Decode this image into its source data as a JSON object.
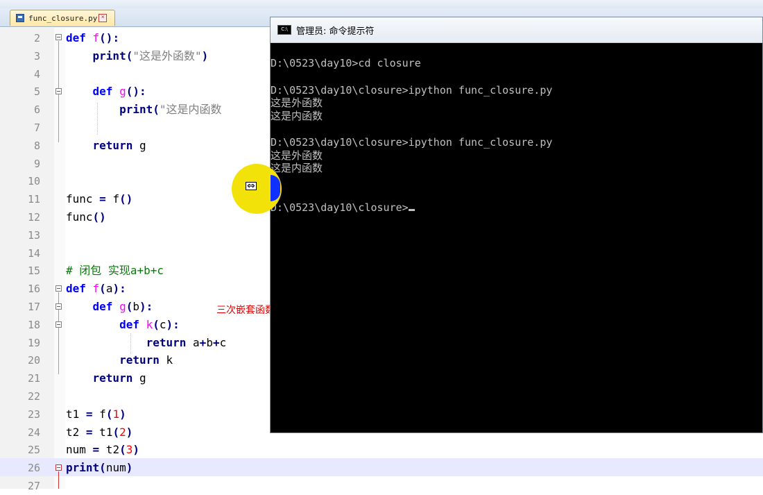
{
  "tab": {
    "filename": "func_closure.py",
    "close_glyph": "×"
  },
  "editor": {
    "lines": [
      {
        "n": "2",
        "parts": [
          [
            "kw",
            "def "
          ],
          [
            "fn",
            "f"
          ],
          [
            "op",
            "():"
          ]
        ]
      },
      {
        "n": "3",
        "parts": [
          [
            "",
            "    "
          ],
          [
            "kwb",
            "print"
          ],
          [
            "op",
            "("
          ],
          [
            "str",
            "\"这是外函数\""
          ],
          [
            "op",
            ")"
          ]
        ]
      },
      {
        "n": "4",
        "parts": []
      },
      {
        "n": "5",
        "parts": [
          [
            "",
            "    "
          ],
          [
            "kw",
            "def "
          ],
          [
            "fn",
            "g"
          ],
          [
            "op",
            "():"
          ]
        ]
      },
      {
        "n": "6",
        "parts": [
          [
            "",
            "        "
          ],
          [
            "kwb",
            "print"
          ],
          [
            "op",
            "("
          ],
          [
            "str",
            "\"这是内函数"
          ]
        ]
      },
      {
        "n": "7",
        "parts": []
      },
      {
        "n": "8",
        "parts": [
          [
            "",
            "    "
          ],
          [
            "kwb",
            "return "
          ],
          [
            "",
            "g"
          ]
        ]
      },
      {
        "n": "9",
        "parts": []
      },
      {
        "n": "10",
        "parts": []
      },
      {
        "n": "11",
        "parts": [
          [
            "",
            "func "
          ],
          [
            "op",
            "="
          ],
          [
            "",
            " f"
          ],
          [
            "op",
            "()"
          ]
        ]
      },
      {
        "n": "12",
        "parts": [
          [
            "",
            "func"
          ],
          [
            "op",
            "()"
          ]
        ]
      },
      {
        "n": "13",
        "parts": []
      },
      {
        "n": "14",
        "parts": []
      },
      {
        "n": "15",
        "parts": [
          [
            "cm",
            "# 闭包 实现a+b+c"
          ]
        ]
      },
      {
        "n": "16",
        "parts": [
          [
            "kw",
            "def "
          ],
          [
            "fn",
            "f"
          ],
          [
            "op",
            "("
          ],
          [
            "",
            "a"
          ],
          [
            "op",
            "):"
          ]
        ]
      },
      {
        "n": "17",
        "parts": [
          [
            "",
            "    "
          ],
          [
            "kw",
            "def "
          ],
          [
            "fn",
            "g"
          ],
          [
            "op",
            "("
          ],
          [
            "",
            "b"
          ],
          [
            "op",
            "):"
          ]
        ]
      },
      {
        "n": "18",
        "parts": [
          [
            "",
            "        "
          ],
          [
            "kw",
            "def "
          ],
          [
            "fn",
            "k"
          ],
          [
            "op",
            "("
          ],
          [
            "",
            "c"
          ],
          [
            "op",
            "):"
          ]
        ]
      },
      {
        "n": "19",
        "parts": [
          [
            "",
            "            "
          ],
          [
            "kwb",
            "return "
          ],
          [
            "",
            "a"
          ],
          [
            "op",
            "+"
          ],
          [
            "",
            "b"
          ],
          [
            "op",
            "+"
          ],
          [
            "",
            "c"
          ]
        ]
      },
      {
        "n": "20",
        "parts": [
          [
            "",
            "        "
          ],
          [
            "kwb",
            "return "
          ],
          [
            "",
            "k"
          ]
        ]
      },
      {
        "n": "21",
        "parts": [
          [
            "",
            "    "
          ],
          [
            "kwb",
            "return "
          ],
          [
            "",
            "g"
          ]
        ]
      },
      {
        "n": "22",
        "parts": []
      },
      {
        "n": "23",
        "parts": [
          [
            "",
            "t1 "
          ],
          [
            "op",
            "="
          ],
          [
            "",
            " f"
          ],
          [
            "op",
            "("
          ],
          [
            "num",
            "1"
          ],
          [
            "op",
            ")"
          ]
        ]
      },
      {
        "n": "24",
        "parts": [
          [
            "",
            "t2 "
          ],
          [
            "op",
            "="
          ],
          [
            "",
            " t1"
          ],
          [
            "op",
            "("
          ],
          [
            "num",
            "2"
          ],
          [
            "op",
            ")"
          ]
        ]
      },
      {
        "n": "25",
        "parts": [
          [
            "",
            "num "
          ],
          [
            "op",
            "="
          ],
          [
            "",
            " t2"
          ],
          [
            "op",
            "("
          ],
          [
            "num",
            "3"
          ],
          [
            "op",
            ")"
          ]
        ]
      },
      {
        "n": "26",
        "parts": [
          [
            "kwb",
            "print"
          ],
          [
            "op",
            "("
          ],
          [
            "",
            "num"
          ],
          [
            "op",
            ")"
          ]
        ]
      },
      {
        "n": "27",
        "parts": []
      }
    ],
    "annotation": "三次嵌套函数形成的闭包"
  },
  "cmd": {
    "title": "管理员: 命令提示符",
    "icon_text": "C:\\",
    "output": [
      {
        "row": 1,
        "text": "D:\\0523\\day10>cd closure"
      },
      {
        "row": 3,
        "text": "D:\\0523\\day10\\closure>ipython func_closure.py"
      },
      {
        "row": 4,
        "text": "这是外函数"
      },
      {
        "row": 5,
        "text": "这是内函数"
      },
      {
        "row": 7,
        "text": "D:\\0523\\day10\\closure>ipython func_closure.py"
      },
      {
        "row": 8,
        "text": "这是外函数"
      },
      {
        "row": 9,
        "text": "这是内函数"
      },
      {
        "row": 10,
        "text": "6"
      },
      {
        "row": 12,
        "text": "D:\\0523\\day10\\closure>",
        "cursor": true
      }
    ]
  },
  "mouse": {
    "glyph": "⇔"
  }
}
